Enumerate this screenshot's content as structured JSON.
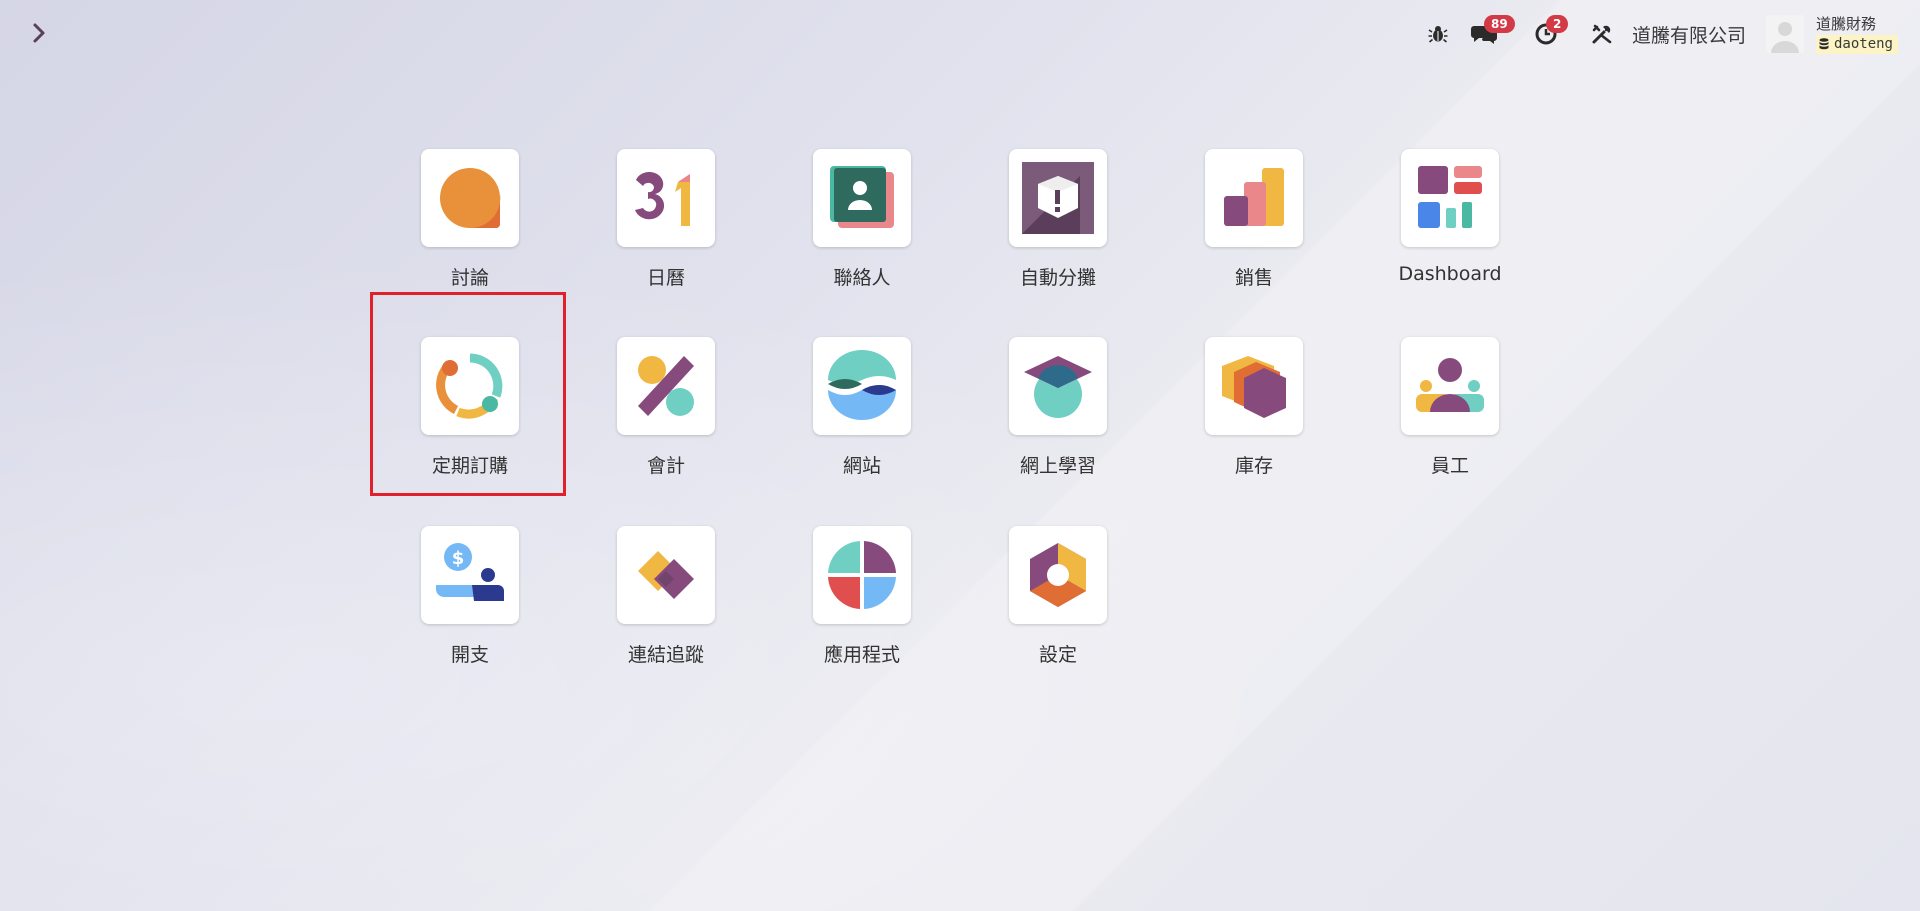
{
  "topbar": {
    "chat_badge": "89",
    "activity_badge": "2",
    "company": "道騰有限公司",
    "user_name": "道騰財務",
    "database": "daoteng"
  },
  "apps": [
    {
      "label": "討論",
      "icon": "discuss-icon"
    },
    {
      "label": "日曆",
      "icon": "calendar-icon"
    },
    {
      "label": "聯絡人",
      "icon": "contacts-icon"
    },
    {
      "label": "自動分攤",
      "icon": "automation-box-icon"
    },
    {
      "label": "銷售",
      "icon": "sales-chart-icon"
    },
    {
      "label": "Dashboard",
      "icon": "dashboard-icon"
    },
    {
      "label": "定期訂購",
      "icon": "subscription-icon"
    },
    {
      "label": "會計",
      "icon": "accounting-percent-icon"
    },
    {
      "label": "網站",
      "icon": "website-icon"
    },
    {
      "label": "網上學習",
      "icon": "elearning-cap-icon"
    },
    {
      "label": "庫存",
      "icon": "inventory-box-icon"
    },
    {
      "label": "員工",
      "icon": "employees-icon"
    },
    {
      "label": "開支",
      "icon": "expenses-icon"
    },
    {
      "label": "連結追蹤",
      "icon": "link-tracker-icon"
    },
    {
      "label": "應用程式",
      "icon": "apps-icon"
    },
    {
      "label": "設定",
      "icon": "settings-icon"
    }
  ],
  "colors": {
    "highlight": "#e0202a",
    "badge": "#d23a47",
    "database_tag": "#fcf4c4"
  }
}
